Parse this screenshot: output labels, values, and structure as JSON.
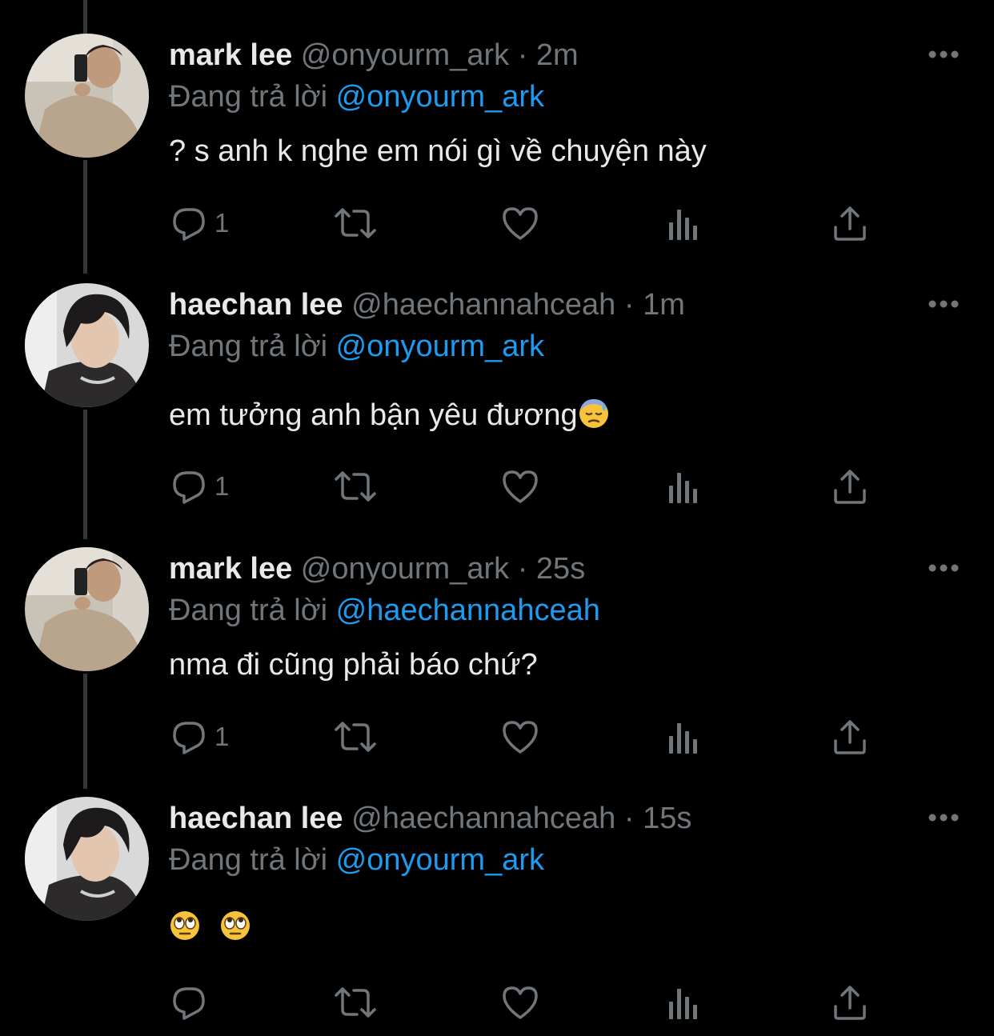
{
  "colors": {
    "background": "#000000",
    "text_primary": "#e7e9ea",
    "text_secondary": "#71767b",
    "link": "#1d9bf0",
    "thread_line": "#333639"
  },
  "reply_prefix": "Đang trả lời",
  "tweets": [
    {
      "name": "mark lee",
      "handle": "@onyourm_ark",
      "separator": "·",
      "time": "2m",
      "reply_to": "@onyourm_ark",
      "text": "? s anh k nghe em nói gì về chuyện này",
      "emoji": [],
      "reply_count": "1",
      "avatar": "mark-lee-avatar"
    },
    {
      "name": "haechan lee",
      "handle": "@haechannahceah",
      "separator": "·",
      "time": "1m",
      "reply_to": "@onyourm_ark",
      "text": "em tưởng anh bận yêu đương",
      "emoji": [
        "downcast-face-with-sweat-emoji"
      ],
      "reply_count": "1",
      "avatar": "haechan-lee-avatar"
    },
    {
      "name": "mark lee",
      "handle": "@onyourm_ark",
      "separator": "·",
      "time": "25s",
      "reply_to": "@haechannahceah",
      "text": "nma đi cũng phải báo chứ?",
      "emoji": [],
      "reply_count": "1",
      "avatar": "mark-lee-avatar"
    },
    {
      "name": "haechan lee",
      "handle": "@haechannahceah",
      "separator": "·",
      "time": "15s",
      "reply_to": "@onyourm_ark",
      "text": "",
      "emoji": [
        "face-with-rolling-eyes-emoji",
        "face-with-rolling-eyes-emoji"
      ],
      "reply_count": "",
      "avatar": "haechan-lee-avatar"
    }
  ],
  "icons": {
    "reply": "reply-icon",
    "retweet": "retweet-icon",
    "like": "heart-icon",
    "views": "views-icon",
    "share": "share-icon",
    "more": "more-icon"
  }
}
